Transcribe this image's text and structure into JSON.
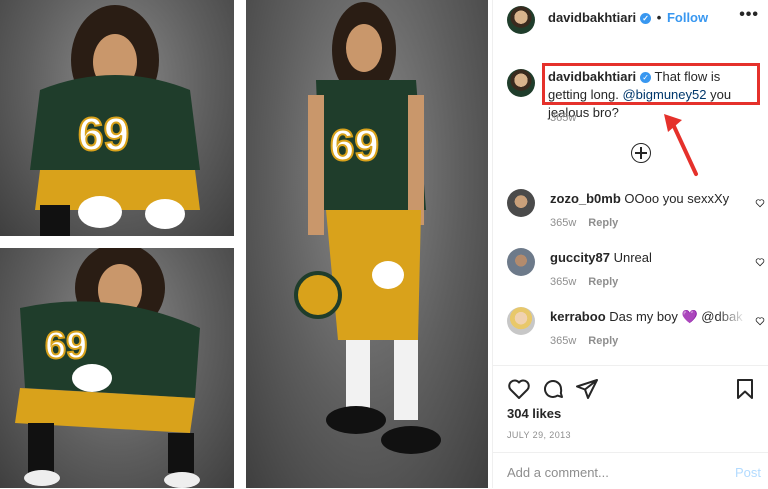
{
  "post": {
    "username": "davidbakhtiari",
    "follow_label": "Follow",
    "more_label": "•••",
    "separator": "•",
    "caption_user": "davidbakhtiari",
    "caption_pre": " That flow is getting long. ",
    "caption_mention": "@bigmuney52",
    "caption_post": " you jealous bro?",
    "caption_time": "365w",
    "likes": "304 likes",
    "date": "JULY 29, 2013"
  },
  "comments": [
    {
      "user": "zozo_b0mb",
      "text": " OOoo you sexxXy",
      "time": "365w",
      "reply": "Reply"
    },
    {
      "user": "guccity87",
      "text": " Unreal",
      "time": "365w",
      "reply": "Reply"
    },
    {
      "user": "kerraboo",
      "text": " Das my boy 💜 @dbak",
      "time": "365w",
      "reply": "Reply"
    }
  ],
  "add_comment": {
    "placeholder": "Add a comment...",
    "post_label": "Post"
  },
  "icons": [
    "verified-badge-icon",
    "more-icon",
    "load-more-icon",
    "heart-icon",
    "comment-icon",
    "share-icon",
    "bookmark-icon"
  ],
  "colors": {
    "accent": "#3897f0",
    "highlight": "#e5312b",
    "jersey_green": "#1f3d2b",
    "pants_gold": "#d9a21b"
  }
}
